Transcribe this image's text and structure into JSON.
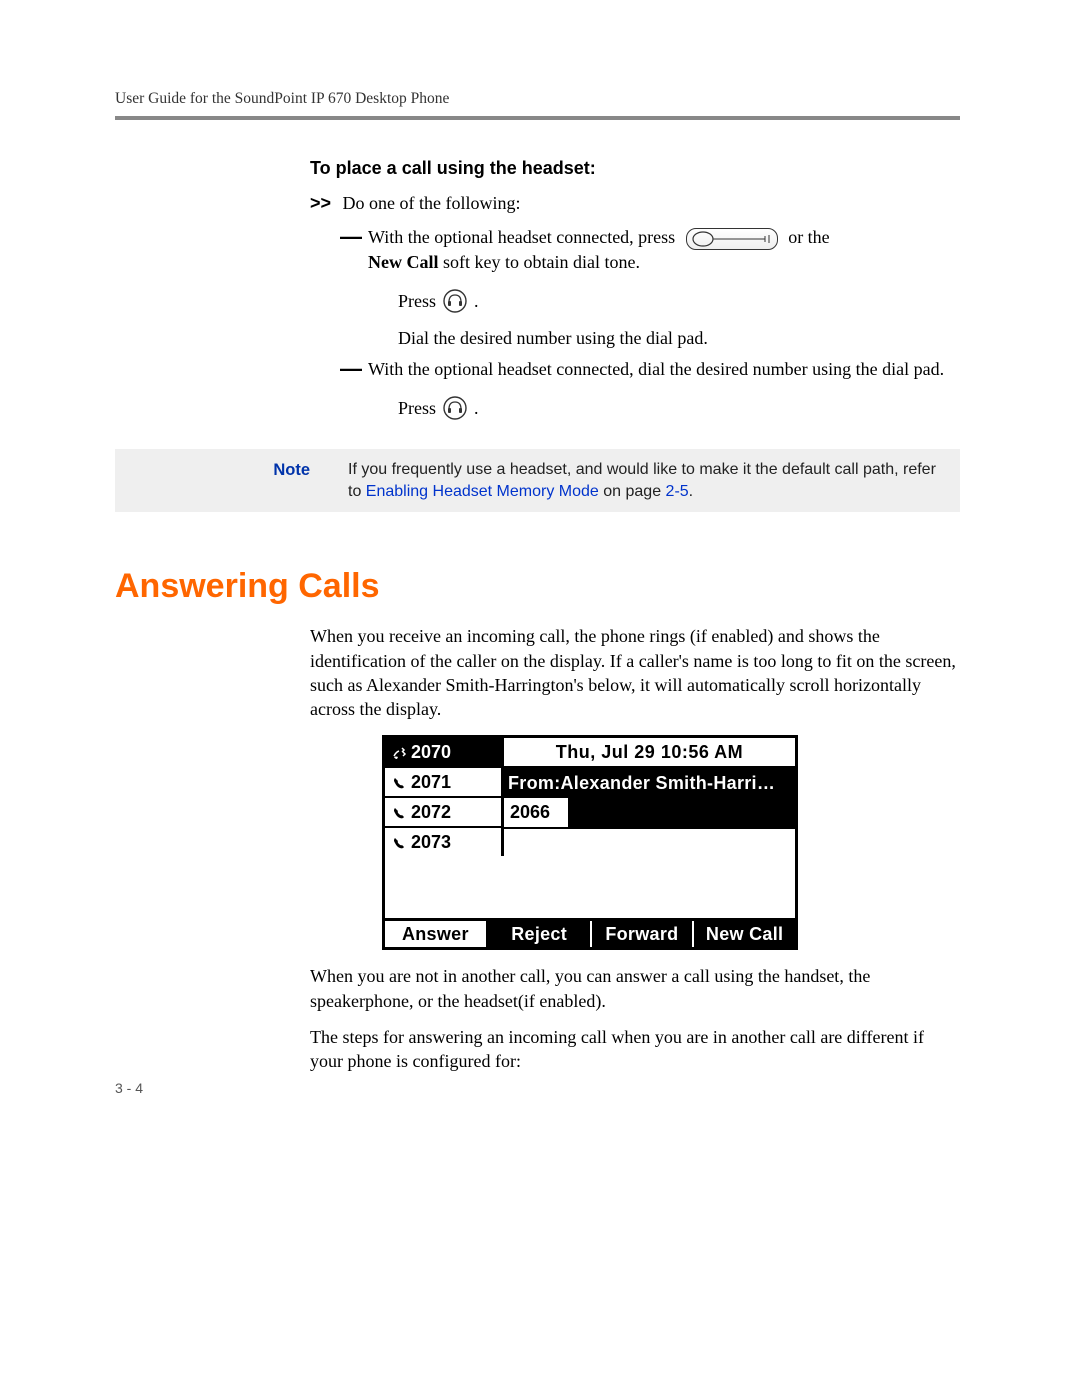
{
  "header": {
    "title": "User Guide for the SoundPoint IP 670 Desktop Phone"
  },
  "headset_section": {
    "heading": "To place a call using the headset:",
    "step_marker": ">>",
    "step_intro": "Do one of the following:",
    "item1_pre": "With the optional headset connected, press",
    "item1_post": "or the",
    "item1_line2_pre": "New Call",
    "item1_line2_post": " soft key to obtain dial tone.",
    "press_label": "Press",
    "period": ".",
    "dial_line": "Dial the desired number using the dial pad.",
    "item2_text": "With the optional headset connected, dial the desired number using the dial pad."
  },
  "note": {
    "label": "Note",
    "text_pre": "If you frequently use a headset, and would like to make it the default call path, refer to ",
    "link_text": "Enabling Headset Memory Mode",
    "text_mid": " on page ",
    "page_ref": "2-5",
    "text_post": "."
  },
  "answering": {
    "heading": "Answering Calls",
    "para1": "When you receive an incoming call, the phone rings (if enabled) and shows the identification of the caller on the display. If a caller's name is too long to fit on the screen, such as Alexander Smith-Harrington's below, it will automatically scroll horizontally across the display.",
    "para2": "When you are not in another call, you can answer a call using the handset, the speakerphone, or the headset(if enabled).",
    "para3": "The steps for answering an incoming call when you are in another call are different if your phone is configured for:"
  },
  "phone_screen": {
    "lines": [
      "2070",
      "2071",
      "2072",
      "2073"
    ],
    "datetime": "Thu, Jul 29  10:56 AM",
    "from_label": "From:Alexander Smith-Harri…",
    "caller_number": "2066",
    "softkeys": [
      "Answer",
      "Reject",
      "Forward",
      "New Call"
    ]
  },
  "page_number": "3 - 4"
}
